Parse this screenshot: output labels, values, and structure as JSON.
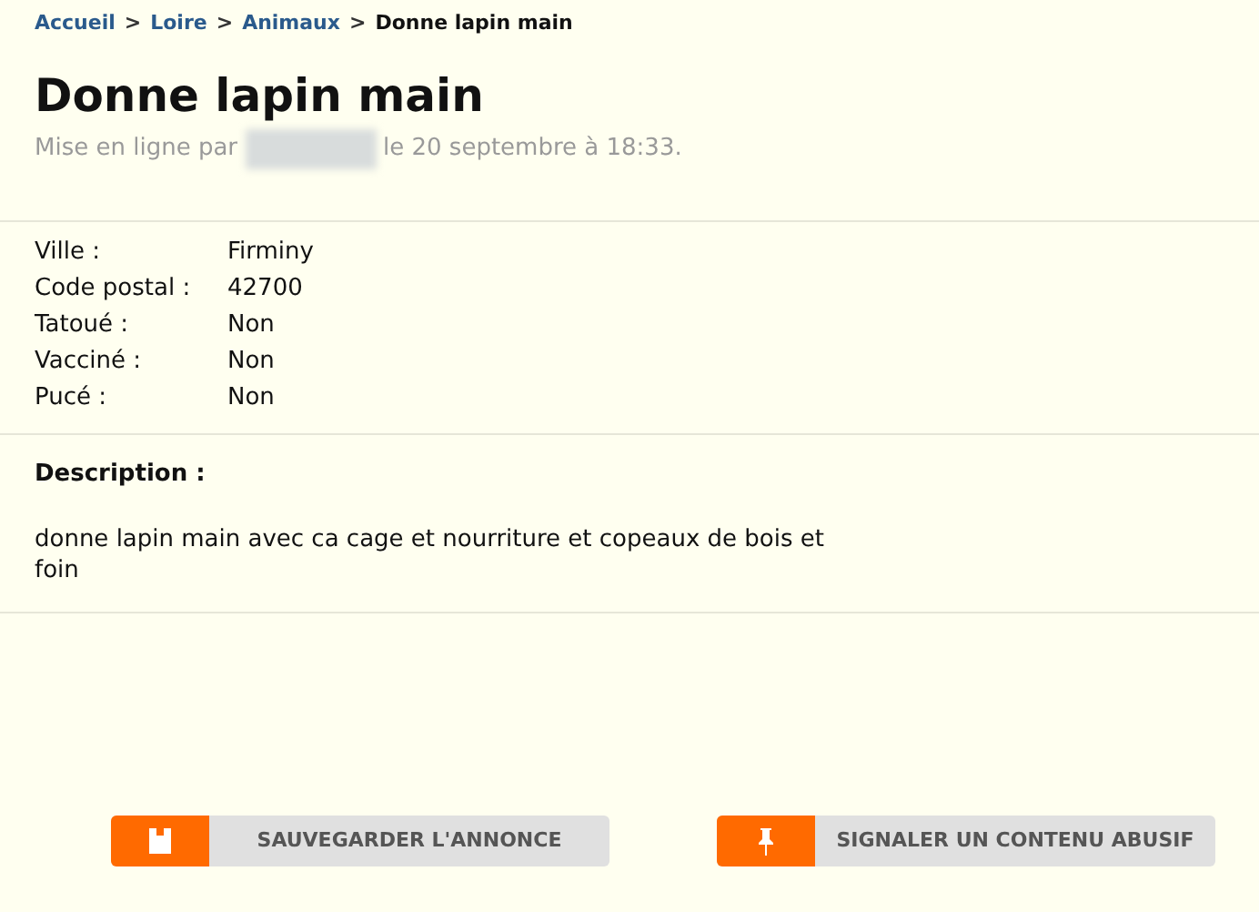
{
  "breadcrumb": [
    {
      "label": "Accueil",
      "kind": "link"
    },
    {
      "label": "Loire",
      "kind": "link"
    },
    {
      "label": "Animaux",
      "kind": "link"
    },
    {
      "label": "Donne lapin main",
      "kind": "current"
    }
  ],
  "breadcrumb_separator": ">",
  "title": "Donne lapin main",
  "posted": {
    "prefix": "Mise en ligne par",
    "suffix": "le 20 septembre à 18:33."
  },
  "details": [
    {
      "label": "Ville :",
      "value": "Firminy"
    },
    {
      "label": "Code postal :",
      "value": "42700"
    },
    {
      "label": "Tatoué :",
      "value": "Non"
    },
    {
      "label": "Vacciné :",
      "value": "Non"
    },
    {
      "label": "Pucé :",
      "value": "Non"
    }
  ],
  "description": {
    "heading": "Description :",
    "text": "donne lapin main avec ca cage et nourriture et copeaux de bois et foin"
  },
  "buttons": [
    {
      "label": "SAUVEGARDER L'ANNONCE",
      "kind": "save"
    },
    {
      "label": "SIGNALER UN CONTENU ABUSIF",
      "kind": "report"
    }
  ]
}
